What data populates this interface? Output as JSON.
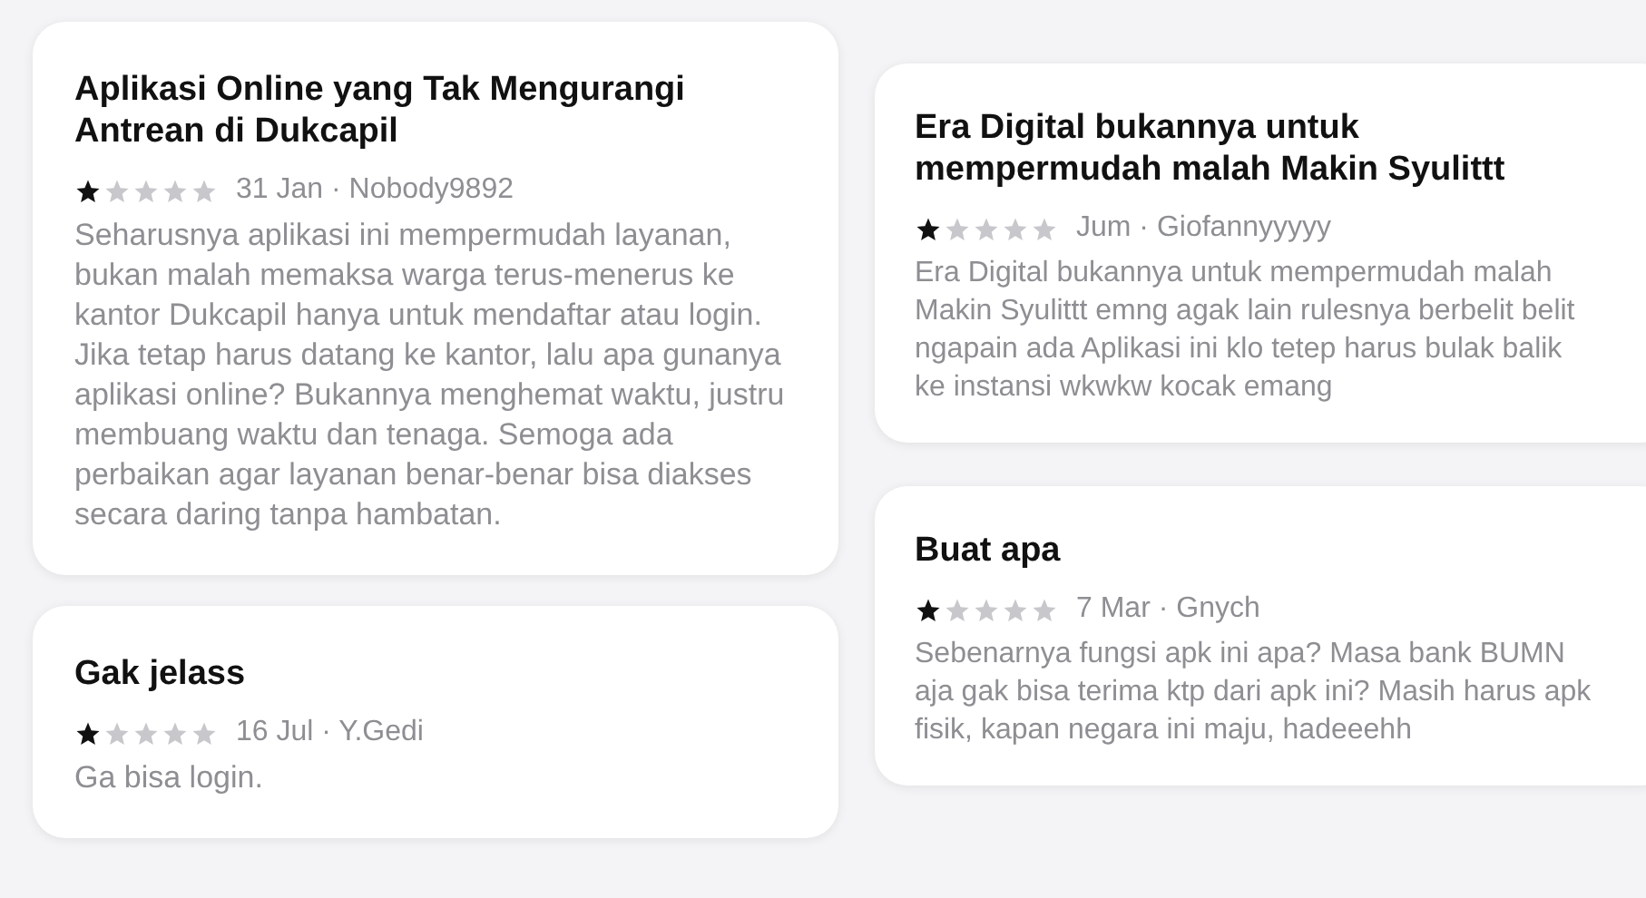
{
  "columns": [
    [
      {
        "title": "Aplikasi Online yang Tak Mengurangi Antrean di Dukcapil",
        "stars": 1,
        "meta": "31 Jan · Nobody9892",
        "body": "Seharusnya aplikasi ini mempermudah layanan, bukan malah memaksa warga terus-menerus ke kantor Dukcapil hanya untuk mendaftar atau login. Jika tetap harus datang ke kantor, lalu apa gunanya aplikasi online? Bukannya menghemat waktu, justru membuang waktu dan tenaga. Semoga ada perbaikan agar layanan benar-benar bisa diakses secara daring tanpa hambatan."
      },
      {
        "title": "Gak jelass",
        "stars": 1,
        "meta": "16 Jul · Y.Gedi",
        "body": "Ga bisa login."
      }
    ],
    [
      {
        "title": "Era Digital bukannya untuk mempermudah malah Makin Syulittt",
        "stars": 1,
        "meta": "Jum · Giofannyyyyy",
        "body": "Era Digital bukannya untuk mempermudah malah Makin Syulittt emng agak lain rulesnya berbelit belit ngapain ada Aplikasi ini klo tetep harus bulak balik ke instansi wkwkw kocak emang"
      },
      {
        "title": "Buat apa",
        "stars": 1,
        "meta": "7 Mar · Gnych",
        "body": "Sebenarnya fungsi apk ini apa? Masa bank BUMN aja gak bisa terima ktp dari apk ini? Masih harus apk fisik, kapan negara ini maju, hadeeehh"
      }
    ]
  ]
}
